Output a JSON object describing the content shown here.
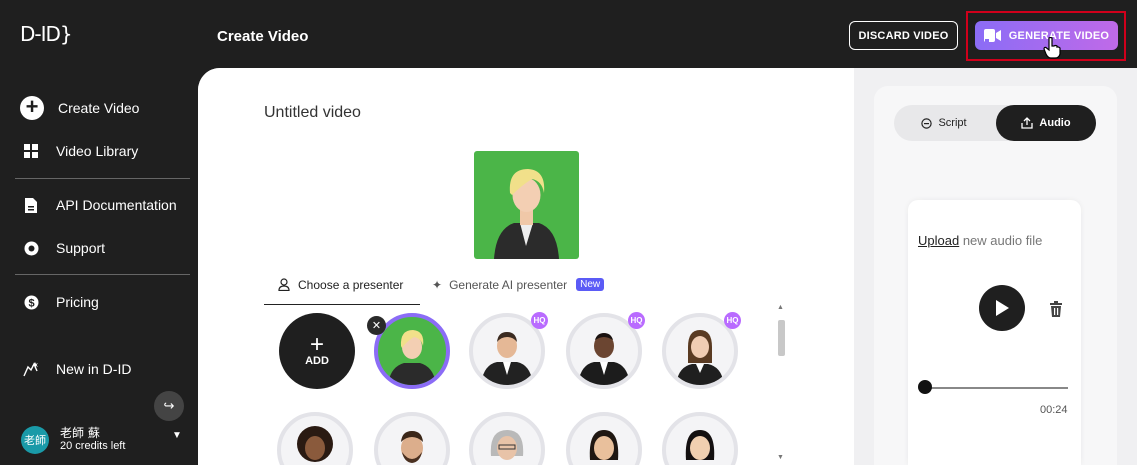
{
  "app": {
    "logo": "D-ID}",
    "page_title": "Create Video"
  },
  "header": {
    "discard_label": "DISCARD VIDEO",
    "generate_label": "GENERATE VIDEO"
  },
  "sidebar": {
    "items": [
      {
        "label": "Create Video",
        "icon": "plus-circle-icon"
      },
      {
        "label": "Video Library",
        "icon": "grid-icon"
      },
      {
        "label": "API Documentation",
        "icon": "document-icon"
      },
      {
        "label": "Support",
        "icon": "lifebuoy-icon"
      },
      {
        "label": "Pricing",
        "icon": "dollar-icon"
      },
      {
        "label": "New in D-ID",
        "icon": "sparkle-hand-icon"
      }
    ],
    "user": {
      "avatar_text": "老師",
      "name": "老師 蘇",
      "credits": "20 credits left"
    }
  },
  "editor": {
    "video_title": "Untitled video",
    "tabs": [
      {
        "label": "Choose a presenter",
        "active": true
      },
      {
        "label": "Generate AI presenter",
        "badge": "New"
      }
    ],
    "add_label": "ADD",
    "hq_label": "HQ"
  },
  "audio_panel": {
    "toggle": {
      "script_label": "Script",
      "audio_label": "Audio",
      "active": "Audio"
    },
    "upload_link": "Upload",
    "upload_rest": " new audio file",
    "time": "00:24",
    "progress": 0.0
  },
  "colors": {
    "accent_gradient_start": "#8b6cf6",
    "accent_gradient_end": "#c06ae8",
    "highlight_box": "#d0001b",
    "presenter_bg_green": "#4bb548",
    "hq_badge": "#b96bff",
    "new_badge": "#5b5bf6"
  }
}
